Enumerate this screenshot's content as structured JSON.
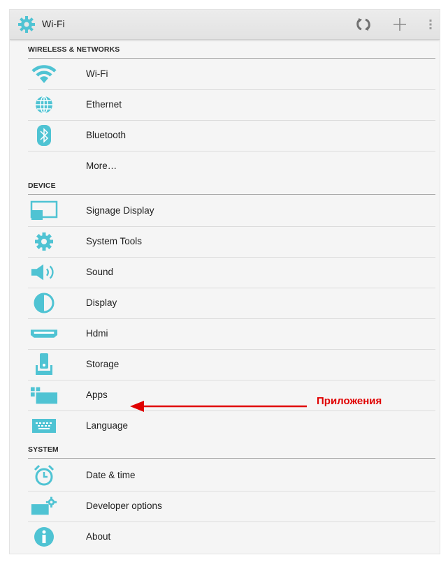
{
  "action_bar": {
    "title": "Wi-Fi",
    "icons": [
      "settings-gear-icon",
      "sync-icon",
      "add-icon",
      "overflow-menu-icon"
    ]
  },
  "sections": {
    "wireless": {
      "header": "WIRELESS & NETWORKS",
      "items": [
        {
          "label": "Wi-Fi",
          "icon": "wifi-icon"
        },
        {
          "label": "Ethernet",
          "icon": "ethernet-globe-icon"
        },
        {
          "label": "Bluetooth",
          "icon": "bluetooth-icon"
        },
        {
          "label": "More…",
          "icon": ""
        }
      ]
    },
    "device": {
      "header": "DEVICE",
      "items": [
        {
          "label": "Signage Display",
          "icon": "signage-display-icon"
        },
        {
          "label": "System Tools",
          "icon": "gear-icon"
        },
        {
          "label": "Sound",
          "icon": "speaker-icon"
        },
        {
          "label": "Display",
          "icon": "brightness-icon"
        },
        {
          "label": "Hdmi",
          "icon": "hdmi-icon"
        },
        {
          "label": "Storage",
          "icon": "storage-icon"
        },
        {
          "label": "Apps",
          "icon": "apps-icon"
        },
        {
          "label": "Language",
          "icon": "keyboard-icon"
        }
      ]
    },
    "system": {
      "header": "SYSTEM",
      "items": [
        {
          "label": "Date & time",
          "icon": "alarm-clock-icon"
        },
        {
          "label": "Developer options",
          "icon": "developer-options-icon"
        },
        {
          "label": "About",
          "icon": "info-icon"
        }
      ]
    }
  },
  "annotation": {
    "text": "Приложения",
    "color": "#e00000"
  },
  "colors": {
    "accent_icon": "#4fc3d3",
    "annotation": "#e00000"
  }
}
